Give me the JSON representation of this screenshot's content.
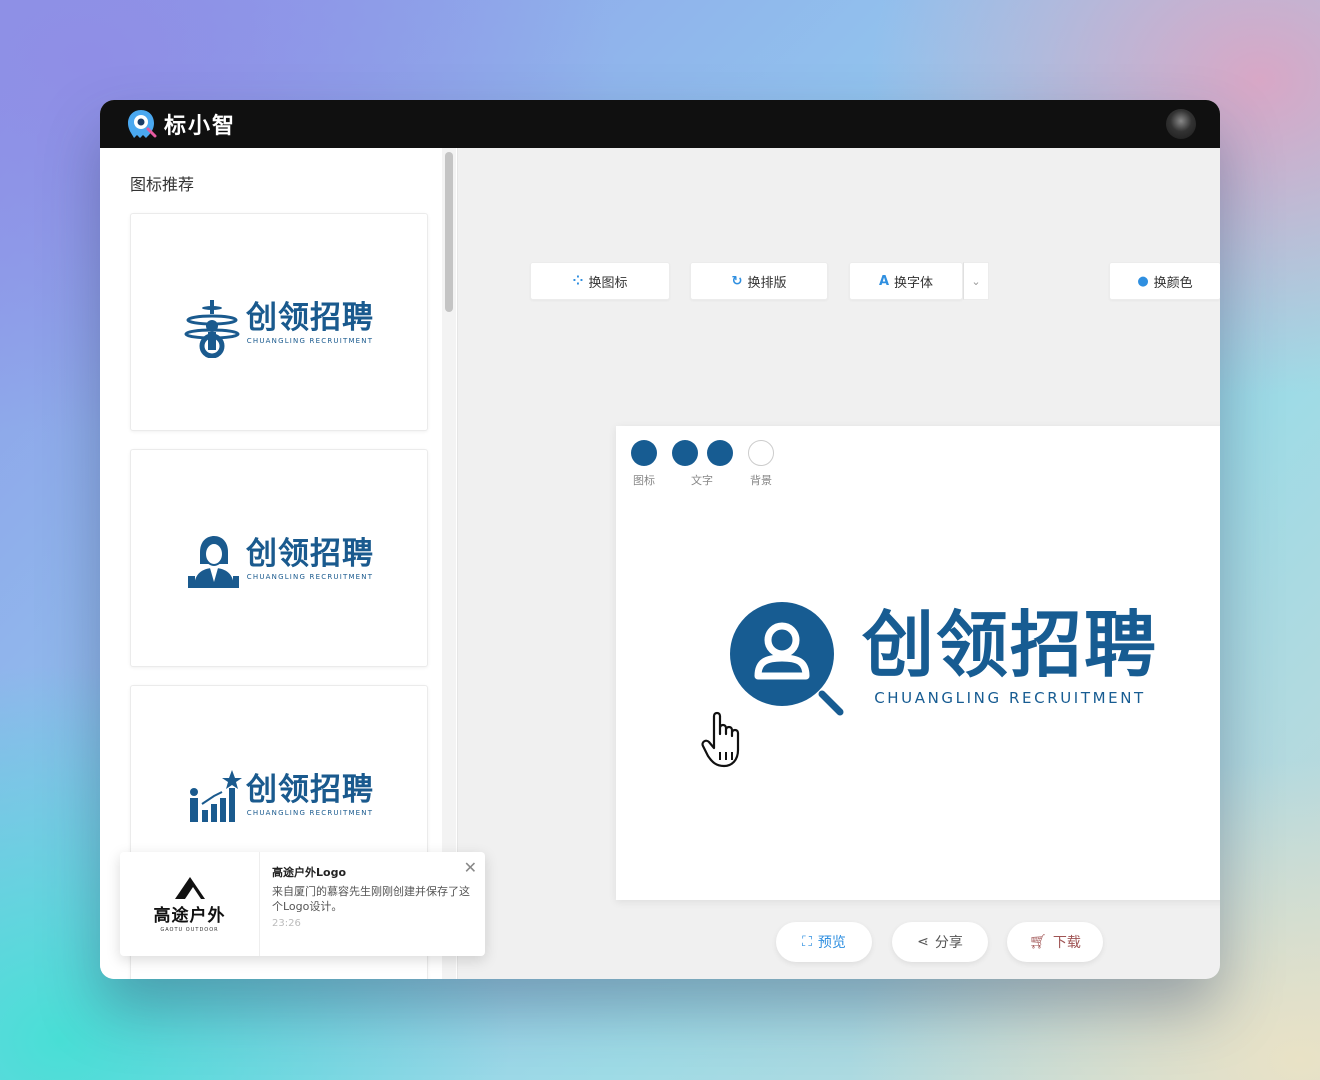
{
  "app": {
    "name": "标小智"
  },
  "sidebar": {
    "title": "图标推荐",
    "cards": [
      {
        "icon": "globe-person-icon",
        "cn": "创领招聘",
        "en": "CHUANGLING RECRUITMENT"
      },
      {
        "icon": "woman-avatar-icon",
        "cn": "创领招聘",
        "en": "CHUANGLING RECRUITMENT"
      },
      {
        "icon": "growth-chart-icon",
        "cn": "创领招聘",
        "en": "CHUANGLING RECRUITMENT"
      }
    ]
  },
  "toolbar": {
    "change_icon": "换图标",
    "change_layout": "换排版",
    "change_font": "换字体",
    "change_color": "换颜色"
  },
  "colors": {
    "swatches": [
      {
        "label": "图标",
        "color": "#175c92"
      },
      {
        "label": "文字",
        "color": "#175c92"
      },
      {
        "label": "",
        "color": "#175c92"
      },
      {
        "label": "背景",
        "color": "#ffffff"
      }
    ]
  },
  "logo": {
    "cn": "创领招聘",
    "en": "CHUANGLING RECRUITMENT",
    "icon": "search-person-icon",
    "color": "#175c92"
  },
  "actions": {
    "preview": "预览",
    "share": "分享",
    "download": "下载"
  },
  "toast": {
    "brand": "高途户外",
    "brand_sub": "GAOTU OUTDOOR",
    "title": "高途户外Logo",
    "message": "来自厦门的慕容先生刚刚创建并保存了这个Logo设计。",
    "time": "23:26"
  }
}
